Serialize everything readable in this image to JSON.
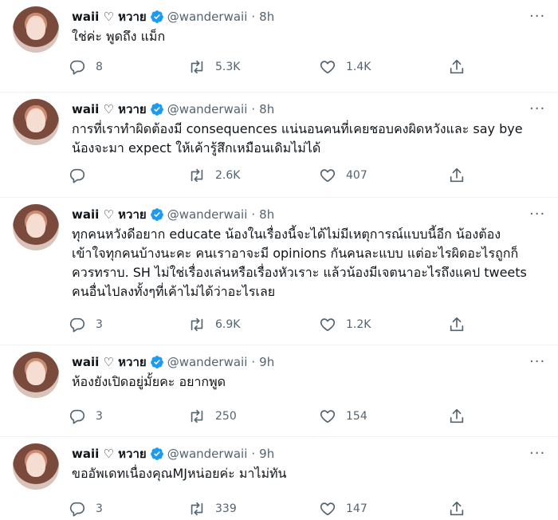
{
  "colors": {
    "verified": "#1d9bf0",
    "secondary_text": "#536471",
    "divider": "#eff3f4"
  },
  "tweets": [
    {
      "name": "waii ♡ หวาย",
      "handle": "@wanderwaii",
      "time": "8h",
      "text": "ใช่ค่ะ พูดถึง แม็ก",
      "replies": "8",
      "retweets": "5.3K",
      "likes": "1.4K"
    },
    {
      "name": "waii ♡ หวาย",
      "handle": "@wanderwaii",
      "time": "8h",
      "text": "การที่เราทำผิดต้องมี consequences แน่นอนคนที่เคยชอบคงผิดหวังและ say bye\nน้องจะมา expect ให้เค้ารู้สึกเหมือนเดิมไม่ได้",
      "replies": "",
      "retweets": "2.6K",
      "likes": "407"
    },
    {
      "name": "waii ♡ หวาย",
      "handle": "@wanderwaii",
      "time": "8h",
      "text": "ทุกคนหวังดีอยาก educate น้องในเรื่องนี้จะได้ไม่มีเหตุการณ์แบบนี้อีก น้องต้อง\nเข้าใจทุกคนบ้างนะคะ คนเราอาจะมี opinions กันคนละแบบ แต่อะไรผิดอะไรถูกก็\nควรทราบ. SH ไม่ใช่เรื่องเล่นหรือเรื่องหัวเราะ แล้วน้องมีเจตนาอะไรถึงแคป tweets\nคนอื่นไปลงทั้งๆที่เค้าไม่ได้ว่าอะไรเลย",
      "replies": "3",
      "retweets": "6.9K",
      "likes": "1.2K"
    },
    {
      "name": "waii ♡ หวาย",
      "handle": "@wanderwaii",
      "time": "9h",
      "text": "ห้องยังเปิดอยู่มั้ยคะ อยากพูด",
      "replies": "3",
      "retweets": "250",
      "likes": "154"
    },
    {
      "name": "waii ♡ หวาย",
      "handle": "@wanderwaii",
      "time": "9h",
      "text": "ขออัพเดทเนื่องคุณMJหน่อยค่ะ มาไม่ทัน",
      "replies": "3",
      "retweets": "339",
      "likes": "147"
    }
  ]
}
